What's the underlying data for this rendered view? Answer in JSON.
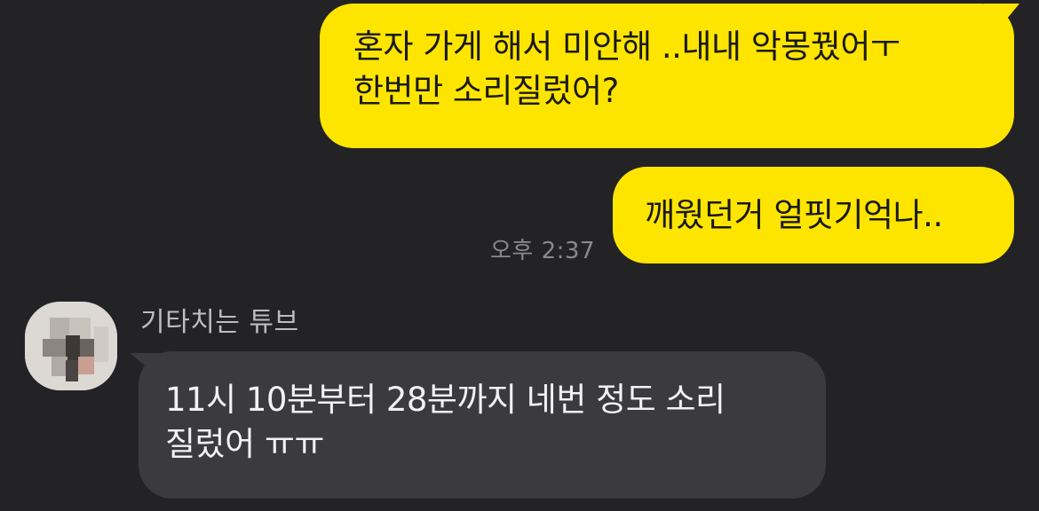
{
  "messages": {
    "sent": [
      {
        "lines": [
          "혼자 가게 해서 미안해 ..내내 악몽꿨어ㅜ",
          "한번만 소리질렀어?"
        ]
      },
      {
        "lines": [
          "깨웠던거 얼핏기억나.."
        ],
        "time": "오후 2:37"
      }
    ],
    "received": {
      "sender_name": "기타치는 튜브",
      "avatar_icon": "blurred-avatar-icon",
      "lines": [
        "11시 10분부터 28분까지 네번 정도 소리",
        "질렀어 ㅠㅠ"
      ]
    }
  },
  "colors": {
    "background": "#232325",
    "sent_bubble": "#fee500",
    "received_bubble": "#3b3b3e",
    "time_text": "#8a8a8c",
    "name_text": "#bdbdc0"
  }
}
